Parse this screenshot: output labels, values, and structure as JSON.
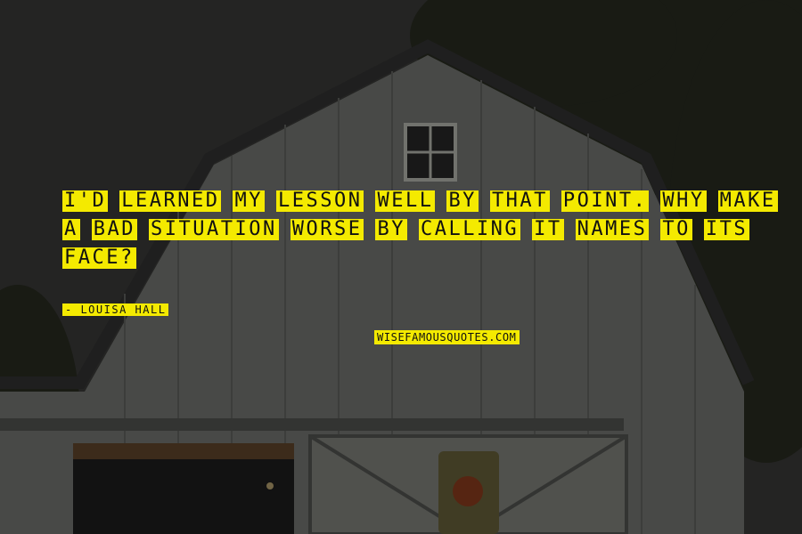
{
  "quote": {
    "lines": [
      [
        "I'D",
        "LEARNED",
        "MY",
        "LESSON",
        "WELL",
        "BY",
        "THAT",
        "POINT.",
        "WHY",
        "MAKE"
      ],
      [
        "A",
        "BAD",
        "SITUATION",
        "WORSE",
        "BY",
        "CALLING",
        "IT",
        "NAMES",
        "TO",
        "ITS"
      ],
      [
        "FACE?"
      ]
    ],
    "author": "- LOUISA HALL"
  },
  "watermark": "WISEFAMOUSQUOTES.COM",
  "colors": {
    "highlight": "#f4ea00",
    "text": "#111111",
    "background": "#2b2b2a"
  }
}
